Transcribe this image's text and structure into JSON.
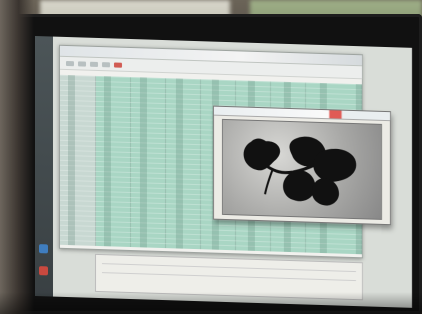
{
  "scene": {
    "type": "photo-of-monitor",
    "monitor_colors": {
      "spreadsheet_fill": "#a9d6c4",
      "screen_background": "#d9ddd8",
      "image_background": "#b8b8b5",
      "plant_silhouette": "#111111"
    }
  },
  "screen": {
    "spreadsheet": {
      "toolbar_icon": "spreadsheet-toolbar-icon"
    },
    "image_window": {
      "subject": "leaf silhouette"
    },
    "taskbar": {
      "icons": [
        "app-icon-blue",
        "app-icon-red"
      ]
    }
  }
}
